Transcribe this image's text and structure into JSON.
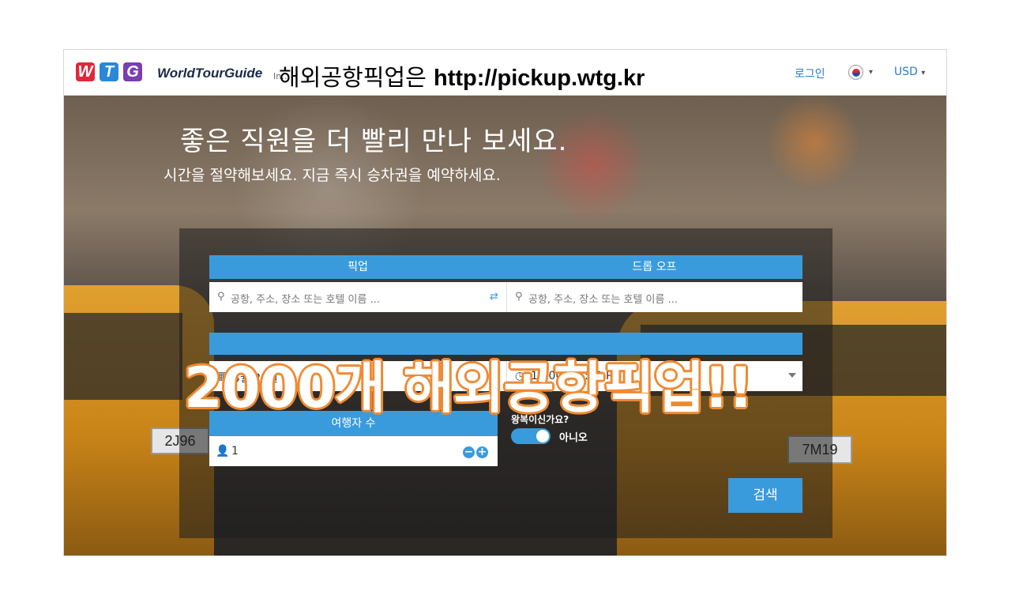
{
  "header": {
    "brand_name": "WorldTourGuide",
    "brand_tagline": "In…",
    "overlay_caption_prefix": "해외공항픽업은",
    "overlay_caption_url": "http://pickup.wtg.kr",
    "login_label": "로그인",
    "language_flag": "korea-flag-icon",
    "currency_label": "USD"
  },
  "hero": {
    "title": "좋은 직원을 더 빨리 만나 보세요.",
    "subtitle": "시간을 절약해보세요. 지금 즉시 승차권을 예약하세요.",
    "overlay_banner": "2000개 해외공항픽업!!"
  },
  "booking": {
    "pickup_label": "픽업",
    "dropoff_label": "드롭 오프",
    "pickup_placeholder": "공항, 주소, 장소 또는 호텔 이름 ...",
    "dropoff_placeholder": "공항, 주소, 장소 또는 호텔 이름 ...",
    "date_value": "4월 21일",
    "time_value": "13:00 (01:00 PM)",
    "passengers_label": "여행자 수",
    "passengers_value": "1",
    "round_trip_label": "왕복이신가요?",
    "round_trip_value": "아니오",
    "search_label": "검색"
  },
  "colors": {
    "accent": "#3a9bdc",
    "overlay_outline": "#ef8a33",
    "logo_w": "#e0283a",
    "logo_t": "#2a88d8",
    "logo_g": "#7a3fb0"
  }
}
